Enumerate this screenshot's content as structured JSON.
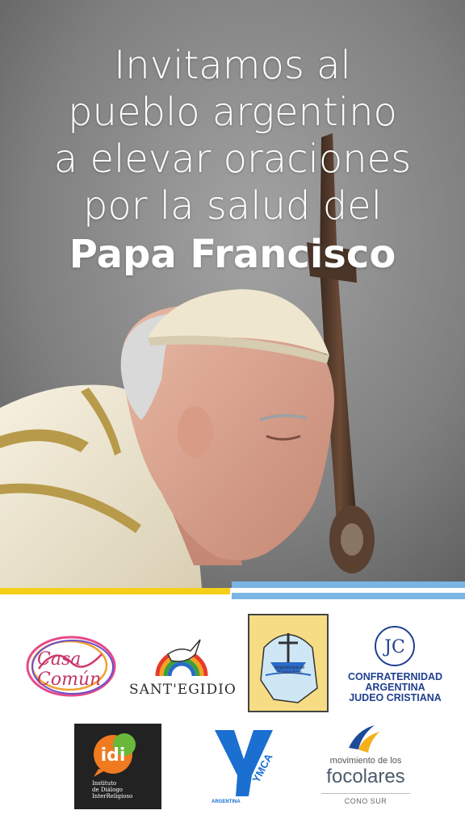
{
  "headline": {
    "line1": "Invitamos al",
    "line2": "pueblo argentino",
    "line3": "a elevar oraciones",
    "line4": "por la salud del",
    "line5": "Papa Francisco"
  },
  "colors": {
    "flag_yellow": "#f5cf1a",
    "flag_blue": "#7ab6e4",
    "confraternidad_blue": "#1f3f8f",
    "ymca_blue": "#1a6fd1"
  },
  "logos": {
    "casa_comun": {
      "text": "Casa Común",
      "icon": "casa-comun-wordmark"
    },
    "santegidio": {
      "text": "SANT'EGIDIO",
      "icon": "dove-rainbow-icon"
    },
    "arquidiocesis": {
      "ring_text": "Comisión de Ecumenismo y de Diálogo Interreligioso",
      "label": "Arquidiócesis de Buenos Aires",
      "icon": "boat-cross-icon"
    },
    "confraternidad": {
      "line1": "CONFRATERNIDAD",
      "line2": "ARGENTINA",
      "line3": "JUDEO CRISTIANA",
      "icon": "confraternidad-monogram-icon"
    },
    "idi": {
      "mark": "idi",
      "line1": "Instituto",
      "line2": "de Diálogo",
      "line3": "InterReligioso",
      "icon": "speech-bubble-icon"
    },
    "ymca": {
      "text": "YMCA",
      "sub": "ARGENTINA",
      "icon": "ymca-y-icon"
    },
    "focolares": {
      "line1": "movimiento de los",
      "line2": "focolares",
      "sub": "CONO SUR",
      "icon": "focolares-swoosh-icon"
    }
  }
}
